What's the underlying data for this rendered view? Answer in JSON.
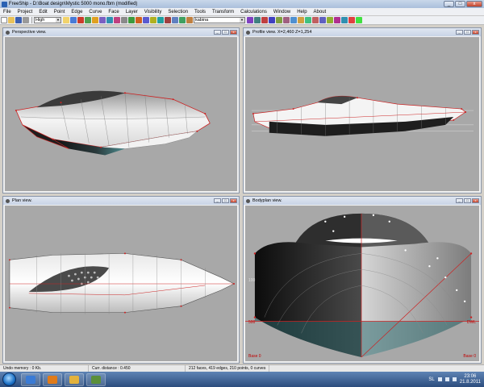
{
  "window": {
    "title": "FreeShip - D:\\Boat design\\Mystic 5000 mono.fbm (modified)",
    "min_label": "_",
    "max_label": "□",
    "close_label": "x"
  },
  "menu": [
    "File",
    "Project",
    "Edit",
    "Point",
    "Edge",
    "Curve",
    "Face",
    "Layer",
    "Visibility",
    "Selection",
    "Tools",
    "Transform",
    "Calculations",
    "Window",
    "Help",
    "About"
  ],
  "toolbar": {
    "precision": "High",
    "layer": "kabina",
    "button_colors": [
      "#f2d36b",
      "#4a7bd6",
      "#cc3c2c",
      "#4fa04f",
      "#e0a020",
      "#7a5fc2",
      "#2f8fb0",
      "#c04080",
      "#8a8a8a",
      "#3d9a3d",
      "#d06020",
      "#5a5ad0",
      "#b0b020",
      "#20a0a0",
      "#a04040",
      "#6080c0",
      "#40a060",
      "#c08040",
      "#8040c0",
      "#408080",
      "#c04040",
      "#4040c0",
      "#80a040",
      "#a06080",
      "#5090d0",
      "#d0a040",
      "#40c080",
      "#c06060",
      "#6060c0",
      "#90b030",
      "#b03090",
      "#3090b0",
      "#e04040",
      "#40e040"
    ]
  },
  "views": {
    "perspective": {
      "title": "Perspective view."
    },
    "profile": {
      "title": "Profile view.   X=2,460   Z=1,254"
    },
    "plan": {
      "title": "Plan view."
    },
    "bodyplan": {
      "title": "Bodyplan view.",
      "label_left": "500",
      "label_right": "DWL",
      "label_bottom_left": "Base 0",
      "label_bottom_right": "Base 0",
      "label_side": "100"
    }
  },
  "statusbar": {
    "memory": "Undo memory : 0 Kb.",
    "distance": "Curr. distance : 0.450",
    "stats": "212 faces, 419 edges, 210 points, 0 curves"
  },
  "taskbar": {
    "lang": "SL",
    "time": "23:06",
    "date": "21.8.2011",
    "task_colors": [
      "#3a7bd5",
      "#e07b1a",
      "#e3b23c",
      "#5a8f3a"
    ]
  },
  "colors": {
    "viewport_bg": "#a8a8a8",
    "hull_edge": "#cc2222",
    "hull_light": "#f4f4f4",
    "hull_dark": "#1c1c1c",
    "hull_teal": "#2e6a70"
  }
}
